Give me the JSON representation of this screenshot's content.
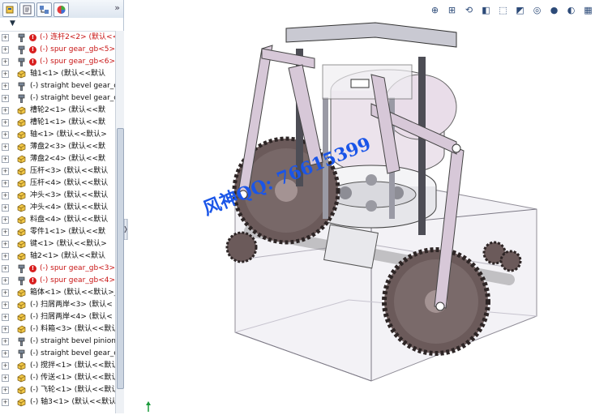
{
  "feature_tree": {
    "tabs": [
      "featuremanager-tab",
      "propertymanager-tab",
      "configurationmanager-tab",
      "displaymanager-tab"
    ],
    "collapse_label": "»",
    "filter_label": "▼",
    "items": [
      {
        "label": "(-) 连杆2<2> (默认<<",
        "error": true,
        "icon": "wrench"
      },
      {
        "label": "(-) spur gear_gb<5>",
        "error": true,
        "icon": "wrench"
      },
      {
        "label": "(-) spur gear_gb<6>",
        "error": true,
        "icon": "wrench"
      },
      {
        "label": "轴1<1> (默认<<默认",
        "error": false,
        "icon": "part"
      },
      {
        "label": "(-) straight bevel gear_c",
        "error": false,
        "icon": "wrench"
      },
      {
        "label": "(-) straight bevel gear_c",
        "error": false,
        "icon": "wrench"
      },
      {
        "label": "槽轮2<1> (默认<<默",
        "error": false,
        "icon": "part"
      },
      {
        "label": "槽轮1<1> (默认<<默",
        "error": false,
        "icon": "part"
      },
      {
        "label": "轴<1> (默认<<默认>",
        "error": false,
        "icon": "part"
      },
      {
        "label": "薄盘2<3> (默认<<默",
        "error": false,
        "icon": "part"
      },
      {
        "label": "薄盘2<4> (默认<<默",
        "error": false,
        "icon": "part"
      },
      {
        "label": "压杆<3> (默认<<默认",
        "error": false,
        "icon": "part"
      },
      {
        "label": "压杆<4> (默认<<默认",
        "error": false,
        "icon": "part"
      },
      {
        "label": "冲头<3> (默认<<默认",
        "error": false,
        "icon": "part"
      },
      {
        "label": "冲头<4> (默认<<默认",
        "error": false,
        "icon": "part"
      },
      {
        "label": "料盘<4> (默认<<默认",
        "error": false,
        "icon": "part"
      },
      {
        "label": "零件1<1> (默认<<默",
        "error": false,
        "icon": "part"
      },
      {
        "label": "键<1> (默认<<默认>",
        "error": false,
        "icon": "part"
      },
      {
        "label": "轴2<1> (默认<<默认",
        "error": false,
        "icon": "part"
      },
      {
        "label": "(-) spur gear_gb<3>",
        "error": true,
        "icon": "wrench"
      },
      {
        "label": "(-) spur gear_gb<4>",
        "error": true,
        "icon": "wrench"
      },
      {
        "label": "箱体<1> (默认<<默认>_",
        "error": false,
        "icon": "part"
      },
      {
        "label": "(-) 扫屑两岸<3> (默认<",
        "error": false,
        "icon": "part"
      },
      {
        "label": "(-) 扫屑两岸<4> (默认<",
        "error": false,
        "icon": "part"
      },
      {
        "label": "(-) 料箱<3> (默认<<默认",
        "error": false,
        "icon": "part"
      },
      {
        "label": "(-) straight bevel pinion",
        "error": false,
        "icon": "wrench"
      },
      {
        "label": "(-) straight bevel gear_c",
        "error": false,
        "icon": "wrench"
      },
      {
        "label": "(-) 搅拌<1> (默认<<默认",
        "error": false,
        "icon": "part"
      },
      {
        "label": "(-) 传送<1> (默认<<默认",
        "error": false,
        "icon": "part"
      },
      {
        "label": "(-) 飞轮<1> (默认<<默认",
        "error": false,
        "icon": "part"
      },
      {
        "label": "(-) 轴3<1> (默认<<默认",
        "error": false,
        "icon": "part"
      }
    ]
  },
  "viewport": {
    "hud_icons": [
      "zoom-to-fit-icon",
      "zoom-area-icon",
      "previous-view-icon",
      "section-view-icon",
      "view-orientation-icon",
      "display-style-icon",
      "hide-show-icon",
      "edit-appearance-icon",
      "apply-scene-icon",
      "view-settings-icon"
    ],
    "watermark": "风神QQ: 76615399"
  },
  "colors": {
    "link": "#d7c8d8",
    "gear": "#5a4a4a",
    "box": "#f0eef4",
    "watermark": "#1a55e8"
  }
}
